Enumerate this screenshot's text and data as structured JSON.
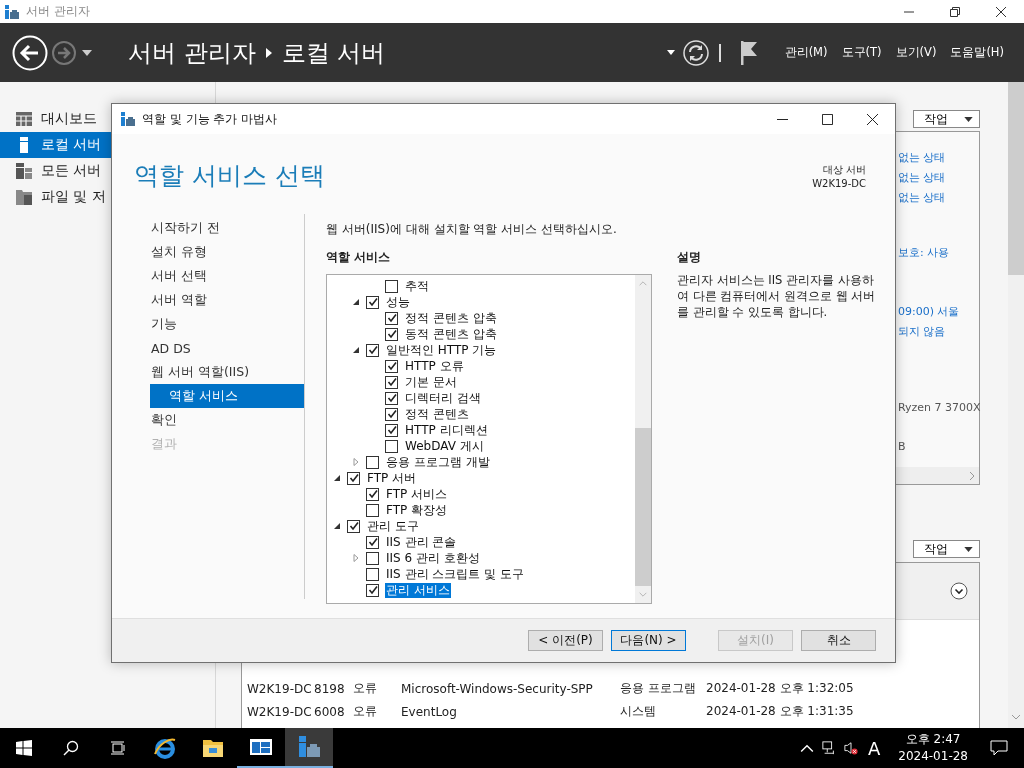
{
  "window": {
    "title": "서버 관리자"
  },
  "header": {
    "breadcrumb": [
      "서버 관리자",
      "로컬 서버"
    ],
    "menus": [
      "관리(M)",
      "도구(T)",
      "보기(V)",
      "도움말(H)"
    ]
  },
  "nav": [
    {
      "kind": "dashboard",
      "label": "대시보드",
      "selected": false
    },
    {
      "kind": "server",
      "label": "로컬 서버",
      "selected": true
    },
    {
      "kind": "servers",
      "label": "모든 서버",
      "selected": false
    },
    {
      "kind": "files",
      "label": "파일 및 저",
      "selected": false
    }
  ],
  "properties": {
    "tasks_button": "작업",
    "values": [
      "없는 상태",
      "없는 상태",
      "없는 상태",
      "보호: 사용",
      "09:00) 서울",
      "되지 않음",
      "Ryzen 7 3700X",
      "B"
    ]
  },
  "events": {
    "tasks_button": "작업",
    "rows": [
      [
        "W2K19-DC",
        "8198",
        "오류",
        "Microsoft-Windows-Security-SPP",
        "응용 프로그램",
        "2024-01-28 오후 1:32:05"
      ],
      [
        "W2K19-DC",
        "6008",
        "오류",
        "EventLog",
        "시스템",
        "2024-01-28 오후 1:31:35"
      ]
    ]
  },
  "wizard": {
    "title": "역할 및 기능 추가 마법사",
    "heading": "역할 서비스 선택",
    "target_label": "대상 서버",
    "target_server": "W2K19-DC",
    "steps": [
      {
        "label": "시작하기 전",
        "selected": false,
        "disabled": false
      },
      {
        "label": "설치 유형",
        "selected": false,
        "disabled": false
      },
      {
        "label": "서버 선택",
        "selected": false,
        "disabled": false
      },
      {
        "label": "서버 역할",
        "selected": false,
        "disabled": false
      },
      {
        "label": "기능",
        "selected": false,
        "disabled": false
      },
      {
        "label": "AD DS",
        "selected": false,
        "disabled": false
      },
      {
        "label": "웹 서버 역할(IIS)",
        "selected": false,
        "disabled": false,
        "children": [
          {
            "label": "역할 서비스",
            "selected": true,
            "disabled": false
          }
        ]
      },
      {
        "label": "확인",
        "selected": false,
        "disabled": false
      },
      {
        "label": "결과",
        "selected": false,
        "disabled": true
      }
    ],
    "instruction": "웹 서버(IIS)에 대해 설치할 역할 서비스 선택하십시오.",
    "tree_heading": "역할 서비스",
    "tree": [
      {
        "children": [
          {
            "children": [
              {
                "label": "추적",
                "checked": false,
                "selected": false
              }
            ]
          },
          {
            "label": "성능",
            "checked": true,
            "selected": false,
            "expanded": true,
            "children": [
              {
                "label": "정적 콘텐츠 압축",
                "checked": true,
                "selected": false
              },
              {
                "label": "동적 콘텐츠 압축",
                "checked": true,
                "selected": false
              }
            ]
          },
          {
            "label": "일반적인 HTTP 기능",
            "checked": true,
            "selected": false,
            "expanded": true,
            "children": [
              {
                "label": "HTTP 오류",
                "checked": true,
                "selected": false
              },
              {
                "label": "기본 문서",
                "checked": true,
                "selected": false
              },
              {
                "label": "디렉터리 검색",
                "checked": true,
                "selected": false
              },
              {
                "label": "정적 콘텐츠",
                "checked": true,
                "selected": false
              },
              {
                "label": "HTTP 리디렉션",
                "checked": true,
                "selected": false
              },
              {
                "label": "WebDAV 게시",
                "checked": false,
                "selected": false
              }
            ]
          },
          {
            "label": "응용 프로그램 개발",
            "checked": false,
            "selected": false,
            "expanded": false
          }
        ]
      },
      {
        "label": "FTP 서버",
        "checked": true,
        "selected": false,
        "expanded": true,
        "children": [
          {
            "label": "FTP 서비스",
            "checked": true,
            "selected": false
          },
          {
            "label": "FTP 확장성",
            "checked": false,
            "selected": false
          }
        ]
      },
      {
        "label": "관리 도구",
        "checked": true,
        "selected": false,
        "expanded": true,
        "children": [
          {
            "label": "IIS 관리 콘솔",
            "checked": true,
            "selected": false
          },
          {
            "label": "IIS 6 관리 호환성",
            "checked": false,
            "selected": false,
            "expanded": false
          },
          {
            "label": "IIS 관리 스크립트 및 도구",
            "checked": false,
            "selected": false
          },
          {
            "label": "관리 서비스",
            "checked": true,
            "selected": true
          }
        ]
      }
    ],
    "description_heading": "설명",
    "description": "관리자 서비스는 IIS 관리자를 사용하여 다른 컴퓨터에서 원격으로 웹 서버를 관리할 수 있도록 합니다.",
    "buttons": [
      {
        "label": "< 이전(P)",
        "disabled": false,
        "default": false
      },
      {
        "label": "다음(N) >",
        "disabled": false,
        "default": true
      },
      {
        "label": "설치(I)",
        "disabled": true,
        "default": false
      },
      {
        "label": "취소",
        "disabled": false,
        "default": false
      }
    ]
  },
  "taskbar": {
    "apps": [
      {
        "kind": "browser",
        "running": false,
        "active": false
      },
      {
        "kind": "folder",
        "running": false,
        "active": false
      },
      {
        "kind": "window",
        "running": true,
        "active": false
      },
      {
        "kind": "server",
        "running": true,
        "active": true
      }
    ],
    "input_indicator": "A",
    "time": "오후 2:47",
    "date": "2024-01-28"
  }
}
